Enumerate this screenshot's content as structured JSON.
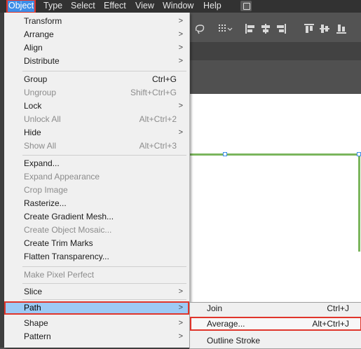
{
  "menubar": {
    "items": [
      "Object",
      "Type",
      "Select",
      "Effect",
      "View",
      "Window",
      "Help"
    ]
  },
  "controlbar": {
    "icons": [
      "lasso-icon",
      "grid-dropdown-icon",
      "align-left-icon",
      "align-center-icon",
      "align-right-icon",
      "align-top-icon",
      "align-middle-icon",
      "align-bottom-icon"
    ]
  },
  "object_menu": {
    "items": [
      {
        "label": "Transform",
        "shortcut": "",
        "submenu": true,
        "disabled": false
      },
      {
        "label": "Arrange",
        "shortcut": "",
        "submenu": true,
        "disabled": false
      },
      {
        "label": "Align",
        "shortcut": "",
        "submenu": true,
        "disabled": false
      },
      {
        "label": "Distribute",
        "shortcut": "",
        "submenu": true,
        "disabled": false
      },
      {
        "label": "Group",
        "shortcut": "Ctrl+G",
        "submenu": false,
        "disabled": false
      },
      {
        "label": "Ungroup",
        "shortcut": "Shift+Ctrl+G",
        "submenu": false,
        "disabled": true
      },
      {
        "label": "Lock",
        "shortcut": "",
        "submenu": true,
        "disabled": false
      },
      {
        "label": "Unlock All",
        "shortcut": "Alt+Ctrl+2",
        "submenu": false,
        "disabled": true
      },
      {
        "label": "Hide",
        "shortcut": "",
        "submenu": true,
        "disabled": false
      },
      {
        "label": "Show All",
        "shortcut": "Alt+Ctrl+3",
        "submenu": false,
        "disabled": true
      },
      {
        "label": "Expand...",
        "shortcut": "",
        "submenu": false,
        "disabled": false
      },
      {
        "label": "Expand Appearance",
        "shortcut": "",
        "submenu": false,
        "disabled": true
      },
      {
        "label": "Crop Image",
        "shortcut": "",
        "submenu": false,
        "disabled": true
      },
      {
        "label": "Rasterize...",
        "shortcut": "",
        "submenu": false,
        "disabled": false
      },
      {
        "label": "Create Gradient Mesh...",
        "shortcut": "",
        "submenu": false,
        "disabled": false
      },
      {
        "label": "Create Object Mosaic...",
        "shortcut": "",
        "submenu": false,
        "disabled": true
      },
      {
        "label": "Create Trim Marks",
        "shortcut": "",
        "submenu": false,
        "disabled": false
      },
      {
        "label": "Flatten Transparency...",
        "shortcut": "",
        "submenu": false,
        "disabled": false
      },
      {
        "label": "Make Pixel Perfect",
        "shortcut": "",
        "submenu": false,
        "disabled": true
      },
      {
        "label": "Slice",
        "shortcut": "",
        "submenu": true,
        "disabled": false
      },
      {
        "label": "Path",
        "shortcut": "",
        "submenu": true,
        "disabled": false
      },
      {
        "label": "Shape",
        "shortcut": "",
        "submenu": true,
        "disabled": false
      },
      {
        "label": "Pattern",
        "shortcut": "",
        "submenu": true,
        "disabled": false
      }
    ]
  },
  "path_submenu": {
    "items": [
      {
        "label": "Join",
        "shortcut": "Ctrl+J"
      },
      {
        "label": "Average...",
        "shortcut": "Alt+Ctrl+J"
      },
      {
        "label": "Outline Stroke",
        "shortcut": ""
      }
    ]
  },
  "colors": {
    "highlight_outline": "#e0352b",
    "menu_hover": "#9dcaf5",
    "active_menu": "#3d8ee8",
    "artwork_stroke": "#7ab55c"
  }
}
